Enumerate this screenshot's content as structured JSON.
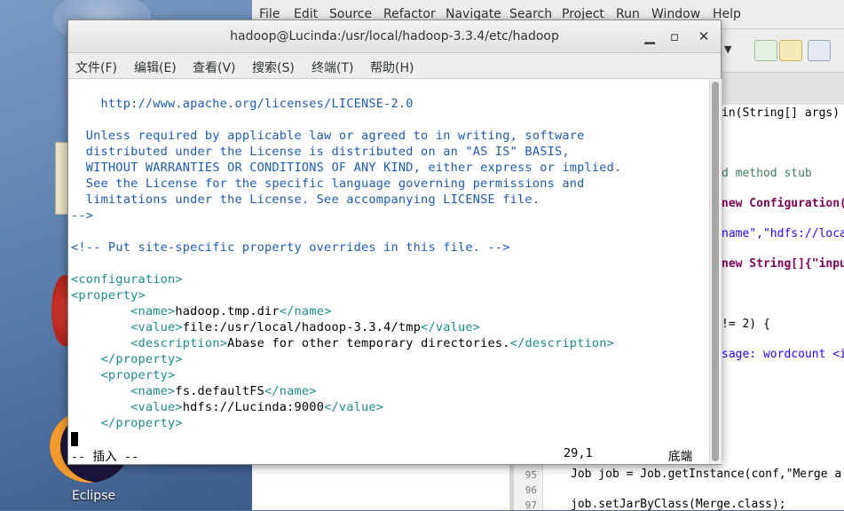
{
  "desktop": {
    "eclipse_icon_label": "Eclipse"
  },
  "eclipse": {
    "menu": [
      "File",
      "Edit",
      "Source",
      "Refactor",
      "Navigate",
      "Search",
      "Project",
      "Run",
      "Window",
      "Help"
    ],
    "code_right": [
      "in(String[] args)",
      "d method stub",
      "new Configuration(",
      "name\",\"hdfs://loca",
      "new String[]{\"inpu",
      "!= 2) {",
      "sage: wordcount <i"
    ],
    "bottom_lines": [
      {
        "num": "95",
        "text": "Job job = Job.getInstance(conf,\"Merge a"
      },
      {
        "num": "96",
        "text": ""
      },
      {
        "num": "97",
        "text": "job.setJarByClass(Merge.class);"
      }
    ]
  },
  "terminal": {
    "title": "hadoop@Lucinda:/usr/local/hadoop-3.3.4/etc/hadoop",
    "menu": [
      "文件(F)",
      "编辑(E)",
      "查看(V)",
      "搜索(S)",
      "终端(T)",
      "帮助(H)"
    ],
    "lines": [
      "    http://www.apache.org/licenses/LICENSE-2.0",
      "",
      "  Unless required by applicable law or agreed to in writing, software",
      "  distributed under the License is distributed on an \"AS IS\" BASIS,",
      "  WITHOUT WARRANTIES OR CONDITIONS OF ANY KIND, either express or implied.",
      "  See the License for the specific language governing permissions and",
      "  limitations under the License. See accompanying LICENSE file.",
      "-->",
      "",
      "<!-- Put site-specific property overrides in this file. -->",
      ""
    ],
    "xml": {
      "configuration_open": "<configuration>",
      "property_open": "<property>",
      "name_open": "<name>",
      "name_close": "</name>",
      "value_open": "<value>",
      "value_close": "</value>",
      "desc_open": "<description>",
      "desc_close": "</description>",
      "property_close": "</property>",
      "p1_name": "hadoop.tmp.dir",
      "p1_value": "file:/usr/local/hadoop-3.3.4/tmp",
      "p1_desc": "Abase for other temporary directories.",
      "p2_name": "fs.defaultFS",
      "p2_value": "hdfs://Lucinda:9000"
    },
    "status_mode": "-- 插入 --",
    "status_pos": "29,1",
    "status_scroll": "底端"
  }
}
